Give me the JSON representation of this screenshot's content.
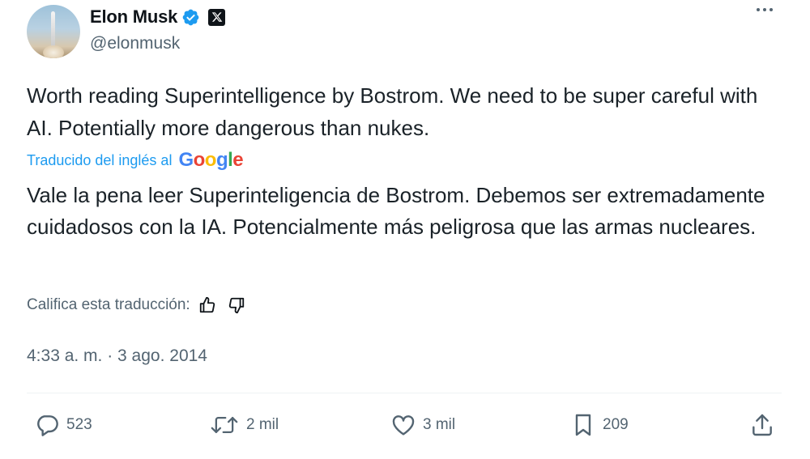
{
  "author": {
    "name": "Elon Musk",
    "handle": "@elonmusk",
    "verified": true
  },
  "tweet": {
    "text": "Worth reading Superintelligence by Bostrom. We need to be super careful with AI. Potentially more dangerous than nukes.",
    "translated_label": "Traducido del inglés al",
    "translation_provider": "Google",
    "translation": "Vale la pena leer Superinteligencia de Bostrom. Debemos ser extremadamente cuidadosos con la IA. Potencialmente más peligrosa que las armas nucleares.",
    "rate_label": "Califica esta traducción:",
    "timestamp": "4:33 a. m. · 3 ago. 2014"
  },
  "actions": {
    "replies": "523",
    "reposts": "2 mil",
    "likes": "3 mil",
    "bookmarks": "209"
  },
  "colors": {
    "accent": "#1d9bf0",
    "secondary_text": "#536471",
    "google_blue": "#4285F4",
    "google_red": "#EA4335",
    "google_yellow": "#FBBC05",
    "google_green": "#34A853"
  },
  "icons": [
    "verified-badge-icon",
    "x-logo-icon",
    "more-icon",
    "thumbs-up-icon",
    "thumbs-down-icon",
    "reply-icon",
    "repost-icon",
    "like-icon",
    "bookmark-icon",
    "share-icon"
  ]
}
